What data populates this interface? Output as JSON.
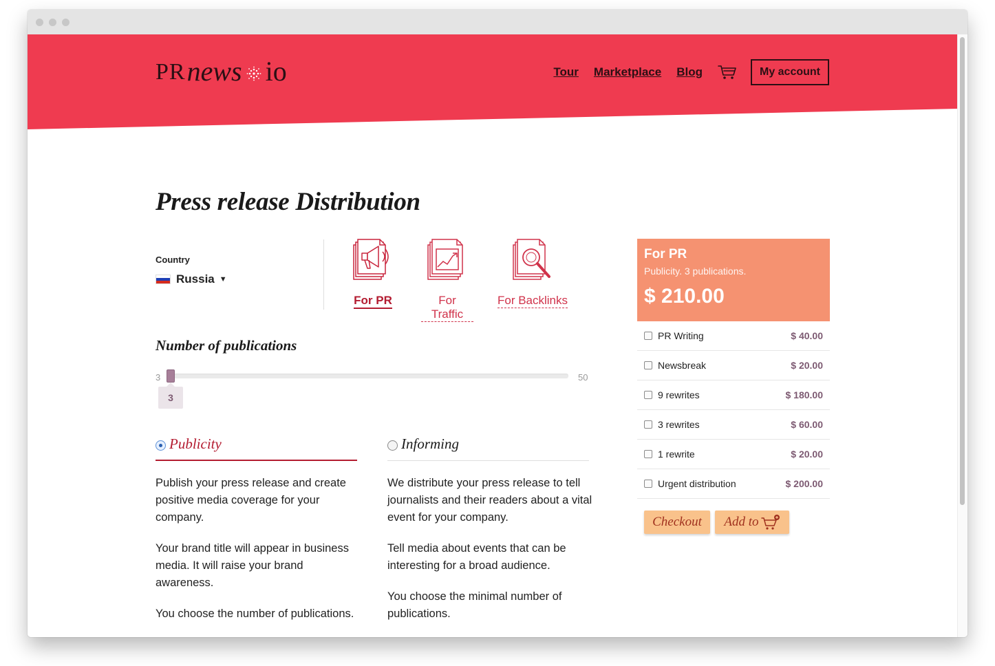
{
  "brand": {
    "logo_pr": "PR",
    "logo_news": "news",
    "logo_io": "io",
    "accent": "#ef3b50"
  },
  "nav": {
    "items": [
      "Tour",
      "Marketplace",
      "Blog"
    ],
    "cart_icon": "cart-icon",
    "account_label": "My account"
  },
  "page_title": "Press release Distribution",
  "country": {
    "label": "Country",
    "value": "Russia",
    "flag_icon": "russia-flag-icon"
  },
  "types": [
    {
      "label": "For PR",
      "icon": "megaphone-icon",
      "active": true
    },
    {
      "label": "For Traffic",
      "icon": "chart-icon",
      "active": false
    },
    {
      "label": "For Backlinks",
      "icon": "magnifier-icon",
      "active": false
    }
  ],
  "publications": {
    "heading": "Number of publications",
    "min": "3",
    "max": "50",
    "value": "3"
  },
  "options": [
    {
      "label": "Publicity",
      "selected": true,
      "paragraphs": [
        "Publish your press release and create positive media coverage for your company.",
        "Your brand title will appear in business media. It will raise your brand awareness.",
        "You choose the number of publications."
      ]
    },
    {
      "label": "Informing",
      "selected": false,
      "paragraphs": [
        "We distribute your press release to tell journalists and their readers about a vital event for your company.",
        "Tell media about events that can be interesting for a broad audience.",
        "You choose the minimal number of publications."
      ]
    }
  ],
  "summary": {
    "title": "For PR",
    "subtitle": "Publicity. 3 publications.",
    "price": "$ 210.00",
    "card_color": "#f59271",
    "extras": [
      {
        "name": "PR Writing",
        "price": "$ 40.00",
        "checked": false
      },
      {
        "name": "Newsbreak",
        "price": "$ 20.00",
        "checked": false
      },
      {
        "name": "9 rewrites",
        "price": "$ 180.00",
        "checked": false
      },
      {
        "name": "3 rewrites",
        "price": "$ 60.00",
        "checked": false
      },
      {
        "name": "1 rewrite",
        "price": "$ 20.00",
        "checked": false
      },
      {
        "name": "Urgent distribution",
        "price": "$ 200.00",
        "checked": false
      }
    ],
    "checkout_label": "Checkout",
    "add_to_label": "Add to",
    "add_to_icon": "add-to-cart-icon"
  }
}
